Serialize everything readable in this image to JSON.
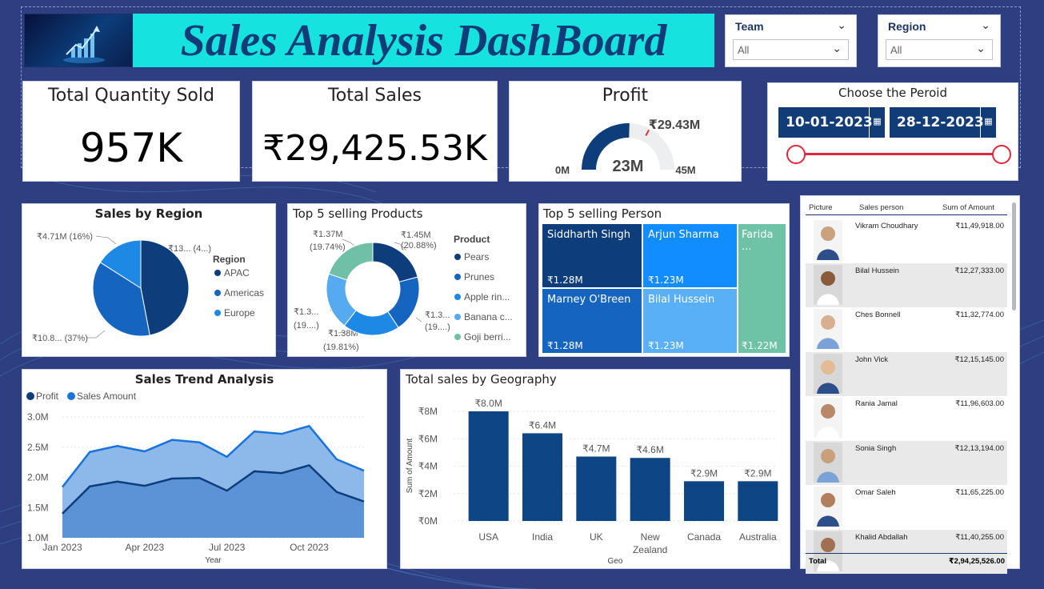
{
  "header": {
    "title": "Sales Analysis DashBoard"
  },
  "slicers": {
    "team": {
      "label": "Team",
      "value": "All"
    },
    "region": {
      "label": "Region",
      "value": "All"
    }
  },
  "kpis": {
    "quantity": {
      "title": "Total Quantity Sold",
      "value": "957K"
    },
    "sales": {
      "title": "Total Sales",
      "value": "₹29,425.53K"
    },
    "profit": {
      "title": "Profit",
      "value": "23M",
      "target": "₹29.43M",
      "min": "0M",
      "max": "45M",
      "fraction": 0.51
    }
  },
  "period": {
    "title": "Choose the Peroid",
    "start": "10-01-2023",
    "end": "28-12-2023"
  },
  "sales_by_region": {
    "title": "Sales by Region",
    "legend_title": "Region",
    "labels": [
      "₹13... (4...)",
      "₹10.8... (37%)",
      "₹4.71M (16%)"
    ],
    "chart_data": {
      "type": "pie",
      "categories": [
        "APAC",
        "Americas",
        "Europe"
      ],
      "values": [
        47,
        37,
        16
      ],
      "colors": [
        "#0d3d7a",
        "#1565c0",
        "#1e88e5"
      ]
    }
  },
  "top_products": {
    "title": "Top 5 selling Products",
    "legend_title": "Product",
    "legend": [
      "Pears",
      "Prunes",
      "Apple rin...",
      "Banana c...",
      "Goji berri..."
    ],
    "labels": [
      {
        "l1": "₹1.45M",
        "l2": "(20.88%)"
      },
      {
        "l1": "₹1.3...",
        "l2": "(19....)"
      },
      {
        "l1": "₹1.38M",
        "l2": "(19.81%)"
      },
      {
        "l1": "₹1.3...",
        "l2": "(19....)"
      },
      {
        "l1": "₹1.37M",
        "l2": "(19.74%)"
      }
    ],
    "chart_data": {
      "type": "pie",
      "categories": [
        "Pears",
        "Prunes",
        "Apple rin...",
        "Banana c...",
        "Goji berri..."
      ],
      "values": [
        20.88,
        19.8,
        19.81,
        19.77,
        19.74
      ],
      "colors": [
        "#0d3d7a",
        "#1565c0",
        "#1e88e5",
        "#56aaf0",
        "#6fc0a6"
      ]
    }
  },
  "top_persons": {
    "title": "Top 5 selling Person",
    "cells": [
      {
        "name": "Siddharth Singh",
        "value": "₹1.28M"
      },
      {
        "name": "Arjun Sharma",
        "value": "₹1.23M"
      },
      {
        "name": "Farida ...",
        "value": "₹1.22M"
      },
      {
        "name": "Marney O'Breen",
        "value": "₹1.28M"
      },
      {
        "name": "Bilal Hussein",
        "value": "₹1.23M"
      }
    ]
  },
  "table": {
    "headers": [
      "Picture",
      "Sales person",
      "Sum of Amount"
    ],
    "rows": [
      {
        "name": "Vikram Choudhary",
        "amount": "₹11,49,918.00"
      },
      {
        "name": "Bilal Hussein",
        "amount": "₹12,27,333.00"
      },
      {
        "name": "Ches Bonnell",
        "amount": "₹11,32,774.00"
      },
      {
        "name": "John Vick",
        "amount": "₹12,15,145.00"
      },
      {
        "name": "Rania Jamal",
        "amount": "₹11,96,603.00"
      },
      {
        "name": "Sonia Singh",
        "amount": "₹12,13,194.00"
      },
      {
        "name": "Omar Saleh",
        "amount": "₹11,65,225.00"
      },
      {
        "name": "Khalid Abdallah",
        "amount": "₹11,40,255.00"
      }
    ],
    "total_label": "Total",
    "total_amount": "₹2,94,25,526.00"
  },
  "trend": {
    "title": "Sales Trend Analysis",
    "chart_data": {
      "type": "area",
      "x": [
        "Jan 2023",
        "Feb 2023",
        "Mar 2023",
        "Apr 2023",
        "May 2023",
        "Jun 2023",
        "Jul 2023",
        "Aug 2023",
        "Sep 2023",
        "Oct 2023",
        "Nov 2023",
        "Dec 2023"
      ],
      "tick_labels": [
        "Jan 2023",
        "Apr 2023",
        "Jul 2023",
        "Oct 2023"
      ],
      "series": [
        {
          "name": "Profit",
          "values": [
            1.4,
            1.85,
            1.93,
            1.86,
            1.98,
            1.99,
            1.78,
            2.1,
            2.07,
            2.2,
            1.76,
            1.6
          ],
          "color": "#0d3d7a"
        },
        {
          "name": "Sales Amount",
          "values": [
            1.84,
            2.42,
            2.52,
            2.43,
            2.62,
            2.58,
            2.34,
            2.76,
            2.72,
            2.85,
            2.3,
            2.11
          ],
          "color": "#1a73d9"
        }
      ],
      "ylim": [
        1.0,
        3.0
      ],
      "y_ticks": [
        "1.0M",
        "1.5M",
        "2.0M",
        "2.5M",
        "3.0M"
      ],
      "xlabel": "Year"
    }
  },
  "geo": {
    "title": "Total sales by Geography",
    "chart_data": {
      "type": "bar",
      "categories": [
        "USA",
        "India",
        "UK",
        "New Zealand",
        "Canada",
        "Australia"
      ],
      "values": [
        8.0,
        6.4,
        4.7,
        4.6,
        2.9,
        2.9
      ],
      "data_labels": [
        "₹8.0M",
        "₹6.4M",
        "₹4.7M",
        "₹4.6M",
        "₹2.9M",
        "₹2.9M"
      ],
      "ylim": [
        0,
        8
      ],
      "y_ticks": [
        "₹0M",
        "₹2M",
        "₹4M",
        "₹6M",
        "₹8M"
      ],
      "xlabel": "Geo",
      "ylabel": "Sum of Amount",
      "color": "#0d4585"
    }
  }
}
